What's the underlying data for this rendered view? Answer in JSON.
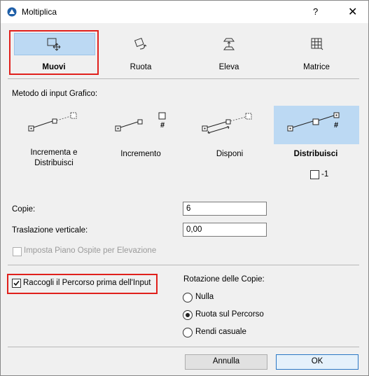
{
  "window": {
    "title": "Moltiplica",
    "help": "?",
    "close": "✕"
  },
  "tabs": [
    {
      "label": "Muovi",
      "icon": "move-icon",
      "active": true
    },
    {
      "label": "Ruota",
      "icon": "rotate-icon",
      "active": false
    },
    {
      "label": "Eleva",
      "icon": "elevate-icon",
      "active": false
    },
    {
      "label": "Matrice",
      "icon": "matrix-icon",
      "active": false
    }
  ],
  "method": {
    "heading": "Metodo di input Grafico:",
    "options": [
      {
        "label": "Incrementa e Distribuisci",
        "selected": false
      },
      {
        "label": "Incremento",
        "selected": false
      },
      {
        "label": "Disponi",
        "selected": false
      },
      {
        "label": "Distribuisci",
        "selected": true
      }
    ],
    "minus_one_label": "-1",
    "hash": "#"
  },
  "fields": {
    "copies_label": "Copie:",
    "copies_value": "6",
    "vertical_label": "Traslazione verticale:",
    "vertical_value": "0,00"
  },
  "host_floor_label": "Imposta Piano Ospite per Elevazione",
  "collect_path_label": "Raccogli il Percorso prima dell'Input",
  "rotation": {
    "heading": "Rotazione delle Copie:",
    "options": [
      {
        "label": "Nulla",
        "selected": false
      },
      {
        "label": "Ruota sul Percorso",
        "selected": true
      },
      {
        "label": "Rendi casuale",
        "selected": false
      }
    ]
  },
  "buttons": {
    "cancel": "Annulla",
    "ok": "OK"
  },
  "colors": {
    "highlight": "#bcd9f3",
    "callout": "#e0201c"
  }
}
